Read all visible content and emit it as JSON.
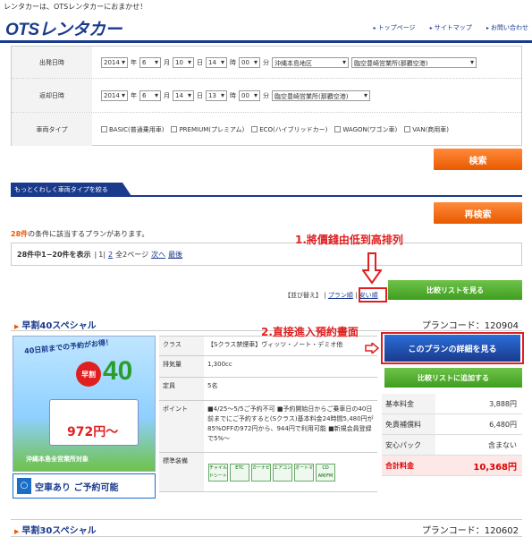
{
  "topbar": {
    "text": "レンタカーは、OTSレンタカーにおまかせ！"
  },
  "logo": "OTSレンタカー",
  "toplinks": [
    "トップページ",
    "サイトマップ",
    "お問い合わせ"
  ],
  "search": {
    "depart_label": "出発日時",
    "return_label": "返却日時",
    "type_label": "車両タイプ",
    "depart": {
      "year": "2014",
      "month": "6",
      "day": "10",
      "hour": "14",
      "min": "00",
      "region": "沖縄本島地区",
      "office": "臨空豊崎営業所(那覇空港)"
    },
    "return": {
      "year": "2014",
      "month": "6",
      "day": "14",
      "hour": "13",
      "min": "00",
      "office": "臨空豊崎営業所(那覇空港)"
    },
    "units": {
      "year": "年",
      "month": "月",
      "day": "日",
      "hour": "時",
      "min": "分"
    },
    "types": [
      "BASIC(普通乗用車)",
      "PREMIUM(プレミアム)",
      "ECO(ハイブリッドカー)",
      "WAGON(ワゴン車)",
      "VAN(商用車)"
    ],
    "search_button": "検索",
    "research_button": "再検索",
    "more_tab": "もっとくわしく車両タイプを絞る"
  },
  "result": {
    "count": "28件",
    "text": "の条件に該当するプランがあります。"
  },
  "pager": {
    "text": "28件中1−20件を表示",
    "p1": "1",
    "p2": "2",
    "total": "全2ページ",
    "next": "次へ",
    "last": "最後"
  },
  "annotations": {
    "sort": "1.將價錢由低到高排列",
    "detail": "2.直接進入預約畫面"
  },
  "sort": {
    "label": "【並び替え】",
    "plan": "プラン順",
    "cheap": "安い順"
  },
  "compare_view": "比較リストを見る",
  "plan1": {
    "title": "早割40スペシャル",
    "code": "プランコード：120904",
    "detail_button": "このプランの詳細を見る",
    "compare_add": "比較リストに追加する",
    "availability": "空車あり ご予約可能",
    "promo": {
      "headline": "40日前までの予約がお得！",
      "badge": "早割",
      "number": "40",
      "office": "沖縄本島全営業所対象",
      "price": "972円〜"
    },
    "spec": {
      "class_label": "クラス",
      "class_value": "【Sクラス禁煙車】ヴィッツ・ノート・デミオ他",
      "cc_label": "排気量",
      "cc_value": "1,300cc",
      "cap_label": "定員",
      "cap_value": "5名",
      "point_label": "ポイント",
      "point_value": "■4/25〜5/5ご予約不可 ■予約開始日からご乗車日の40日前までにご予約すると(Sクラス)基本料金24時間5,480円が85%OFFの972円から、944円で利用可能 ■新規会員登録で5%〜",
      "equip_label": "標準装備",
      "equip": [
        "チャイルドシート",
        "ETC",
        "カーナビ",
        "エアコン",
        "オートマ",
        "CD AM/FM"
      ]
    },
    "prices": [
      {
        "label": "基本料金",
        "value": "3,888円"
      },
      {
        "label": "免責補償料",
        "value": "6,480円"
      },
      {
        "label": "安心パック",
        "value": "含まない"
      },
      {
        "label": "合計料金",
        "value": "10,368円"
      }
    ]
  },
  "plan2": {
    "title": "早割30スペシャル",
    "code": "プランコード：120602"
  }
}
